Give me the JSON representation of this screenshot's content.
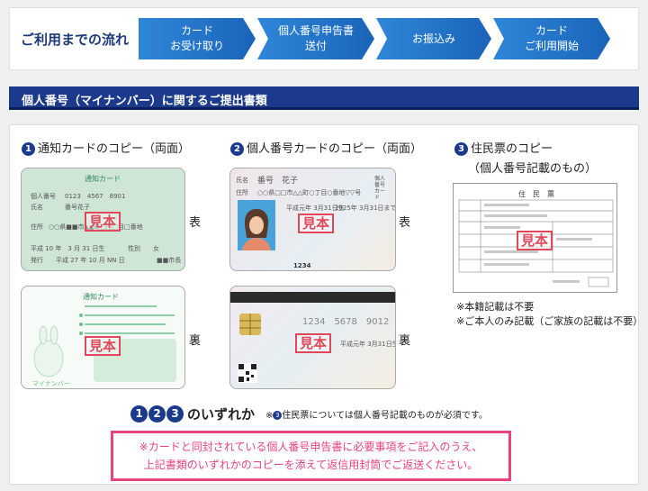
{
  "flow": {
    "title": "ご利用までの流れ",
    "steps": [
      {
        "label": "カード\nお受け取り"
      },
      {
        "label": "個人番号申告書\n送付"
      },
      {
        "label": "お振込み"
      },
      {
        "label": "カード\nご利用開始"
      }
    ]
  },
  "section": {
    "title": "個人番号（マイナンバー）に関するご提出書類"
  },
  "docs": [
    {
      "num": "1",
      "title": "通知カードのコピー（両面）"
    },
    {
      "num": "2",
      "title": "個人番号カードのコピー（両面）"
    },
    {
      "num": "3",
      "title": "住民票のコピー",
      "subtitle": "（個人番号記載のもの）"
    }
  ],
  "labels": {
    "front": "表",
    "back": "裏",
    "sample": "見本"
  },
  "notification_card": {
    "front_title": "通知カード",
    "number_label": "個人番号",
    "number": "0123　4567　8901",
    "name_label": "氏名",
    "name": "番号花子",
    "address_label": "住所",
    "address": "○○県■■市▲▲町□□□目□番地",
    "dob": "平成 10 年　3 月 31 日生",
    "sex_label": "性別",
    "sex": "女",
    "issued": "発行　　平成 27 年 10 月 NN 日",
    "issuer": "■■市長",
    "back_title": "通知カード",
    "mascot_caption": "マイナンバー"
  },
  "mynumber_card": {
    "name_label": "氏名",
    "name": "番号　花子",
    "address_label": "住所",
    "address": "○○県□□市△△町○丁目○番地▽▽号",
    "dob": "平成元年 3月31日生",
    "expiry": "2025年 3月31日まで有効",
    "header": "個人番号カード",
    "number": "1234　5678　9012",
    "back_dob": "平成元年 3月31日生",
    "code": "1234"
  },
  "residence": {
    "title": "住　民　票"
  },
  "notes": [
    "※本籍記載は不要",
    "※ご本人のみ記載（ご家族の記載は不要）"
  ],
  "either": {
    "nums": [
      "1",
      "2",
      "3"
    ],
    "text": "のいずれか",
    "note_prefix": "※",
    "note_num": "3",
    "note": "住民票については個人番号記載のものが必須です。"
  },
  "alert": {
    "line1": "※カードと同封されている個人番号申告書に必要事項をご記入のうえ、",
    "line2": "上記書類のいずれかのコピーを添えて返信用封筒でご返送ください。"
  },
  "colors": {
    "navy": "#1b3a8c",
    "step_blue": "#1e6fc8",
    "pink": "#e8437f",
    "stamp": "#e0485a",
    "card_green": "#cfe5d6"
  }
}
